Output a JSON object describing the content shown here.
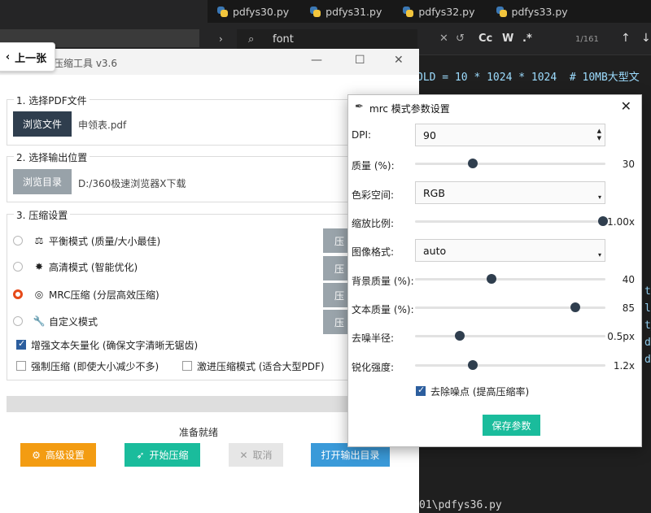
{
  "editor": {
    "tabs": [
      "pdfys30.py",
      "pdfys31.py",
      "pdfys32.py",
      "pdfys33.py"
    ],
    "find": {
      "query": "font",
      "options": [
        "Cc",
        "W",
        ".*"
      ],
      "count": "1/161"
    },
    "code_lines": [
      "OLD = 10 * 1024 * 1024  # 10MB大型文",
      "01\\pdfys36.py"
    ],
    "side_code": [
      "t)",
      "lt",
      "t_",
      "de",
      "de"
    ]
  },
  "main": {
    "title": "压缩工具 v3.6",
    "prev_button": "上一张",
    "section1": {
      "title": "1. 选择PDF文件",
      "button": "浏览文件",
      "file": "申领表.pdf"
    },
    "section2": {
      "title": "2. 选择输出位置",
      "button": "浏览目录",
      "path": "D:/360极速浏览器X下载"
    },
    "section3": {
      "title": "3. 压缩设置",
      "modes": [
        {
          "label": "平衡模式 (质量/大小最佳)",
          "icon": "balance-icon",
          "selected": false
        },
        {
          "label": "高清模式 (智能优化)",
          "icon": "sparkle-icon",
          "selected": false
        },
        {
          "label": "MRC压缩 (分层高效压缩)",
          "icon": "target-icon",
          "selected": true
        },
        {
          "label": "自定义模式",
          "icon": "wrench-icon",
          "selected": false
        }
      ],
      "side_button_label": "压",
      "options": [
        {
          "label": "增强文本矢量化 (确保文字清晰无锯齿)",
          "checked": true
        },
        {
          "label": "强制压缩 (即使大小减少不多)",
          "checked": false
        },
        {
          "label": "激进压缩模式 (适合大型PDF)",
          "checked": false
        }
      ]
    },
    "progress": 0,
    "status": "准备就绪",
    "buttons": {
      "advanced": "高级设置",
      "start": "开始压缩",
      "cancel": "取消",
      "open_output": "打开输出目录"
    },
    "colors": {
      "advanced": "#f39c12",
      "start": "#1abc9c",
      "cancel": "#e6e6e6",
      "open_output": "#3a9ad9"
    }
  },
  "dialog": {
    "title": "mrc 模式参数设置",
    "dpi": {
      "label": "DPI:",
      "value": "90"
    },
    "quality": {
      "label": "质量 (%):",
      "value": "30",
      "fraction": 0.3
    },
    "color_space": {
      "label": "色彩空间:",
      "value": "RGB"
    },
    "scale": {
      "label": "缩放比例:",
      "value": "1.00x",
      "fraction": 1.0
    },
    "image_format": {
      "label": "图像格式:",
      "value": "auto"
    },
    "bg_quality": {
      "label": "背景质量 (%):",
      "value": "40",
      "fraction": 0.4
    },
    "text_quality": {
      "label": "文本质量 (%):",
      "value": "85",
      "fraction": 0.85
    },
    "denoise_radius": {
      "label": "去噪半径:",
      "value": "0.5px",
      "fraction": 0.23
    },
    "sharpen": {
      "label": "锐化强度:",
      "value": "1.2x",
      "fraction": 0.3
    },
    "remove_noise": {
      "label": "去除噪点 (提高压缩率)",
      "checked": true
    },
    "save": "保存参数"
  }
}
